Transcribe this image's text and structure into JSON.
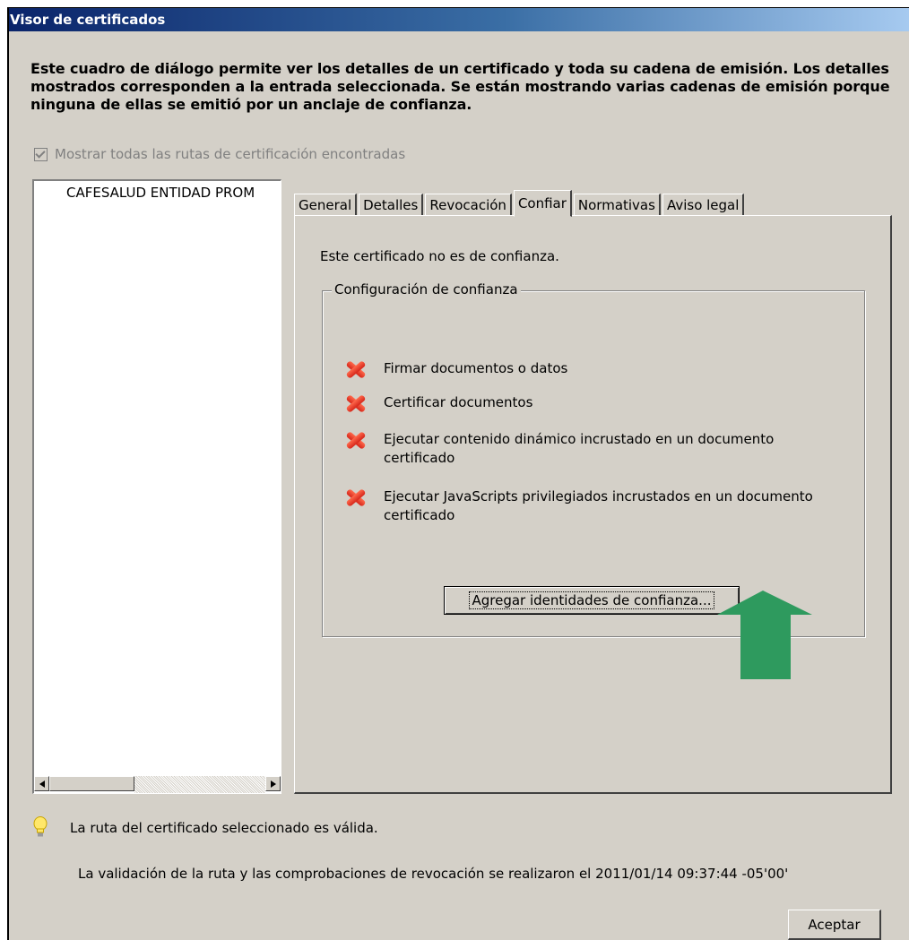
{
  "window": {
    "title": "Visor de certificados"
  },
  "description": "Este cuadro de diálogo permite ver los detalles de un certificado y toda su cadena de emisión. Los detalles mostrados corresponden a la entrada seleccionada. Se están mostrando varias cadenas de emisión porque ninguna de ellas se emitió por un anclaje de confianza.",
  "show_all": {
    "label": "Mostrar todas las rutas de certificación encontradas",
    "checked": true,
    "enabled": false
  },
  "tree": {
    "items": [
      "CAFESALUD ENTIDAD PROM"
    ]
  },
  "tabs": [
    {
      "label": "General",
      "active": false
    },
    {
      "label": "Detalles",
      "active": false
    },
    {
      "label": "Revocación",
      "active": false
    },
    {
      "label": "Confiar",
      "active": true
    },
    {
      "label": "Normativas",
      "active": false
    },
    {
      "label": "Aviso legal",
      "active": false
    }
  ],
  "trust_panel": {
    "status": "Este certificado no es de confianza.",
    "group_label": "Configuración de confianza",
    "items": [
      {
        "icon": "red-x-icon",
        "label": "Firmar documentos o datos"
      },
      {
        "icon": "red-x-icon",
        "label": "Certificar documentos"
      },
      {
        "icon": "red-x-icon",
        "label": "Ejecutar contenido dinámico incrustado en un documento certificado"
      },
      {
        "icon": "red-x-icon",
        "label": "Ejecutar JavaScripts privilegiados incrustados en un documento certificado"
      }
    ],
    "add_button": "Agregar identidades de confianza..."
  },
  "path_status": {
    "icon": "lightbulb-icon",
    "text": "La ruta del certificado seleccionado es válida."
  },
  "validation_text": "La validación de la ruta y las comprobaciones de revocación se realizaron el 2011/01/14 09:37:44 -05'00'",
  "ok_button": "Aceptar",
  "colors": {
    "dialog_bg": "#d4d0c8",
    "title_start": "#0a246a",
    "title_end": "#a6caf0",
    "annotation_arrow": "#2e9a5e",
    "x_icon": "#d6261a"
  }
}
